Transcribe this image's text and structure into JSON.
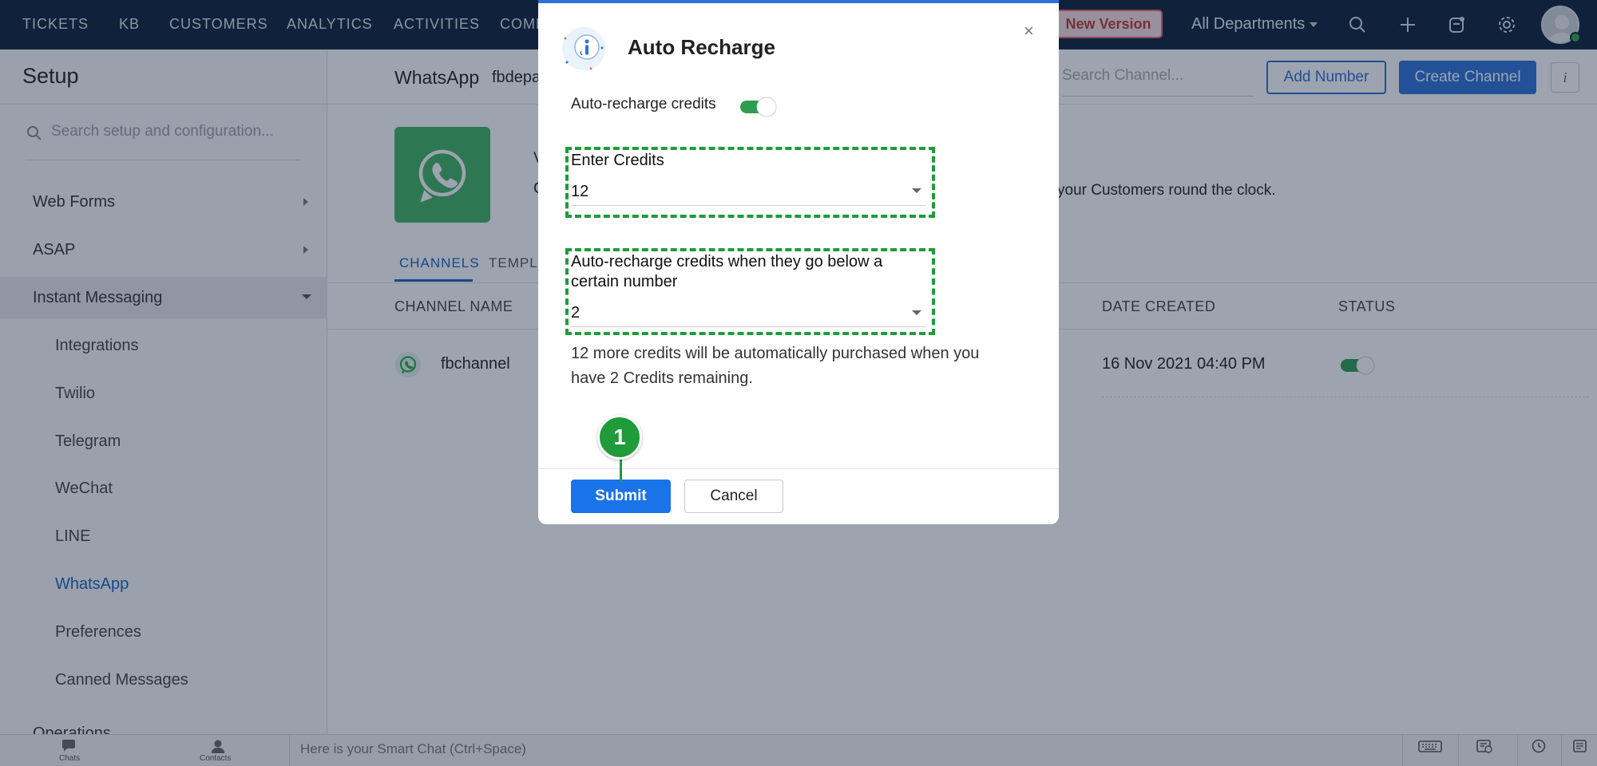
{
  "topnav": {
    "items": [
      "TICKETS",
      "KB",
      "CUSTOMERS",
      "ANALYTICS",
      "ACTIVITIES",
      "COMM"
    ],
    "new_version_label": "New Version",
    "department_label": "All Departments"
  },
  "sidebar": {
    "title": "Setup",
    "search_placeholder": "Search setup and configuration...",
    "items": [
      {
        "label": "Web Forms"
      },
      {
        "label": "ASAP"
      },
      {
        "label": "Instant Messaging"
      }
    ],
    "sub_items": [
      {
        "label": "Integrations"
      },
      {
        "label": "Twilio"
      },
      {
        "label": "Telegram"
      },
      {
        "label": "WeChat"
      },
      {
        "label": "LINE"
      },
      {
        "label": "WhatsApp"
      },
      {
        "label": "Preferences"
      },
      {
        "label": "Canned Messages"
      }
    ],
    "partial_item": "Operations"
  },
  "main": {
    "title": "WhatsApp",
    "subtitle": "fbdepa",
    "search_placeholder": "Search Channel...",
    "add_number_label": "Add Number",
    "create_channel_label": "Create Channel",
    "info_label": "i",
    "description_partial": "C",
    "heading_partial": "V",
    "description_right": "your Customers round the clock.",
    "tabs": [
      {
        "label": "CHANNELS"
      },
      {
        "label": "TEMPLA"
      }
    ],
    "columns": {
      "channel_name": "CHANNEL NAME",
      "date_created": "DATE CREATED",
      "status": "STATUS"
    },
    "row": {
      "name": "fbchannel",
      "date": "16 Nov 2021 04:40 PM",
      "status_enabled": true
    }
  },
  "bottombar": {
    "chats_label": "Chats",
    "contacts_label": "Contacts",
    "smartchat_placeholder": "Here is your Smart Chat (Ctrl+Space)"
  },
  "modal": {
    "title": "Auto Recharge",
    "close_label": "×",
    "toggle_label": "Auto-recharge credits",
    "toggle_on": true,
    "credits_label": "Enter Credits",
    "credits_value": "12",
    "threshold_label": "Auto-recharge credits when they go below a certain number",
    "threshold_value": "2",
    "help_text": "12 more credits will be automatically purchased when you have 2 Credits remaining.",
    "submit_label": "Submit",
    "cancel_label": "Cancel",
    "step_marker": "1"
  },
  "colors": {
    "nav_bg": "#0d2138",
    "accent": "#1a73e8",
    "highlight_green": "#1f9b3a",
    "whatsapp_green": "#3fb55f"
  }
}
